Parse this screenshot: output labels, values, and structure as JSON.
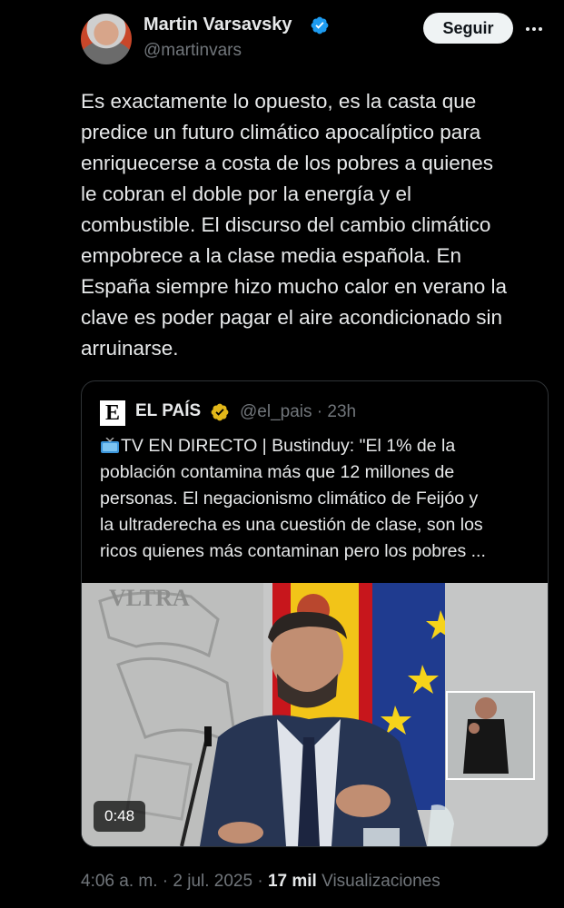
{
  "author": {
    "name": "Martin Varsavsky",
    "handle": "@martinvars",
    "avatar_icon": "profile-photo",
    "verified_color": "#1d9bf0"
  },
  "follow_label": "Seguir",
  "more_icon": "more-horizontal-icon",
  "tweet_text": "Es exactamente lo opuesto, es la casta que\npredice un futuro climático apocalíptico para\nenriquecerse a costa de los pobres a quienes\nle cobran el doble por la energía y el\ncombustible. El discurso del cambio climático\nempobrece a la clase media española. En\nEspaña siempre hizo mucho calor en verano la\nclave es poder pagar el aire acondicionado sin\narruinarse.",
  "quote": {
    "logo_letter": "E",
    "name": "EL PAÍS",
    "badge_color": "#e2b719",
    "handle": "@el_pais",
    "separator": "·",
    "time": "23h",
    "text": "TV EN DIRECTO | Bustinduy: \"El 1% de la\npoblación contamina más que 12 millones de\npersonas. El negacionismo climático de Feijóo y\nla ultraderecha es una cuestión de clase, son los\nricos quienes más contaminan pero los pobres ...",
    "media": {
      "type": "video",
      "wall_lettering": "VLTRA",
      "duration": "0:48"
    }
  },
  "footer": {
    "time": "4:06 a. m.",
    "sep1": "·",
    "date": "2 jul. 2025",
    "sep2": "·",
    "views_count": "17 mil",
    "views_label": "Visualizaciones"
  }
}
